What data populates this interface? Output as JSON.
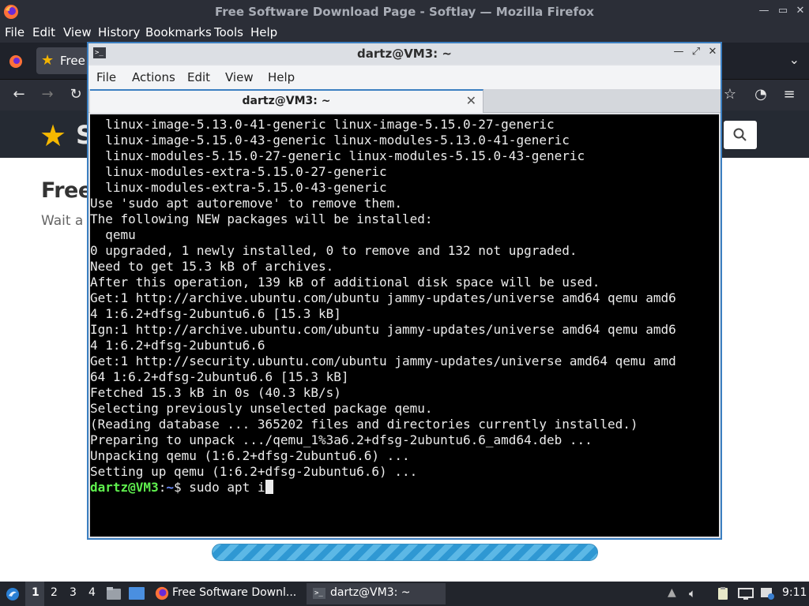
{
  "firefox": {
    "window_title": "Free Software Download Page - Softlay — Mozilla Firefox",
    "window_controls": {
      "minimize": "—",
      "maximize": "▭",
      "close": "✕"
    },
    "menu": [
      "File",
      "Edit",
      "View",
      "History",
      "Bookmarks",
      "Tools",
      "Help"
    ],
    "tab_label": "Free",
    "page": {
      "logo_partial": "S",
      "heading_partial": "Free",
      "subtext_partial": "Wait a r"
    }
  },
  "terminal": {
    "window_title": "dartz@VM3: ~",
    "menu": [
      "File",
      "Actions",
      "Edit",
      "View",
      "Help"
    ],
    "tab_label": "dartz@VM3: ~",
    "lines": [
      "  linux-image-5.13.0-41-generic linux-image-5.15.0-27-generic",
      "  linux-image-5.15.0-43-generic linux-modules-5.13.0-41-generic",
      "  linux-modules-5.15.0-27-generic linux-modules-5.15.0-43-generic",
      "  linux-modules-extra-5.15.0-27-generic",
      "  linux-modules-extra-5.15.0-43-generic",
      "Use 'sudo apt autoremove' to remove them.",
      "The following NEW packages will be installed:",
      "  qemu",
      "0 upgraded, 1 newly installed, 0 to remove and 132 not upgraded.",
      "Need to get 15.3 kB of archives.",
      "After this operation, 139 kB of additional disk space will be used.",
      "Get:1 http://archive.ubuntu.com/ubuntu jammy-updates/universe amd64 qemu amd6",
      "4 1:6.2+dfsg-2ubuntu6.6 [15.3 kB]",
      "Ign:1 http://archive.ubuntu.com/ubuntu jammy-updates/universe amd64 qemu amd6",
      "4 1:6.2+dfsg-2ubuntu6.6",
      "Get:1 http://security.ubuntu.com/ubuntu jammy-updates/universe amd64 qemu amd",
      "64 1:6.2+dfsg-2ubuntu6.6 [15.3 kB]",
      "Fetched 15.3 kB in 0s (40.3 kB/s)",
      "Selecting previously unselected package qemu.",
      "(Reading database ... 365202 files and directories currently installed.)",
      "Preparing to unpack .../qemu_1%3a6.2+dfsg-2ubuntu6.6_amd64.deb ...",
      "Unpacking qemu (1:6.2+dfsg-2ubuntu6.6) ...",
      "Setting up qemu (1:6.2+dfsg-2ubuntu6.6) ..."
    ],
    "prompt": {
      "user_host": "dartz@VM3",
      "sep": ":",
      "path": "~",
      "symbol": "$ ",
      "command": "sudo apt i"
    }
  },
  "taskbar": {
    "workspaces": [
      "1",
      "2",
      "3",
      "4"
    ],
    "active_workspace": "1",
    "tasks": [
      {
        "label": "Free Software Downl...",
        "icon": "firefox-icon"
      },
      {
        "label": "dartz@VM3: ~",
        "icon": "terminal-icon"
      }
    ],
    "clock": "9:11"
  },
  "colors": {
    "terminal_bg": "#000000",
    "prompt_user": "#5ff04e",
    "prompt_path": "#6b8cff",
    "accent": "#3c7fc1",
    "progress": "#2f98d3"
  }
}
